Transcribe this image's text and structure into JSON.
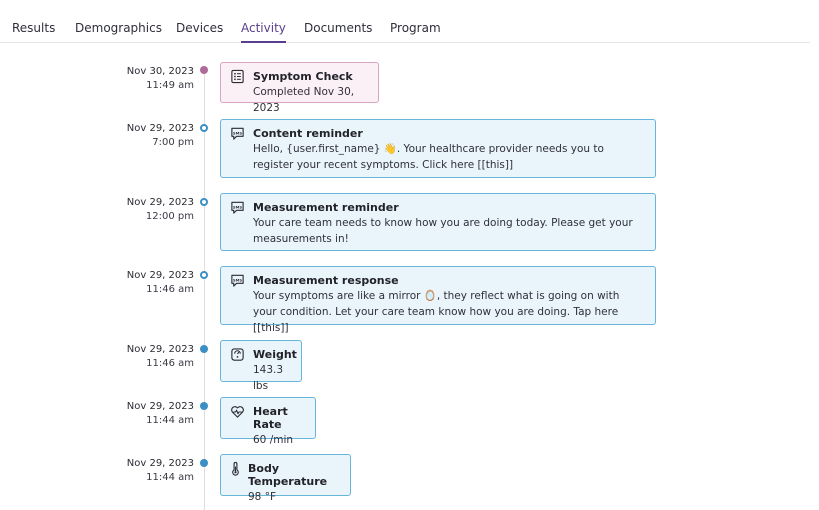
{
  "tabs": [
    {
      "label": "Results"
    },
    {
      "label": "Demographics"
    },
    {
      "label": "Devices"
    },
    {
      "label": "Activity"
    },
    {
      "label": "Documents"
    },
    {
      "label": "Program"
    }
  ],
  "active_tab": "Activity",
  "colors": {
    "accent": "#5a3e8e",
    "card_border": "#67b5d9",
    "card_bg": "#eaf5fb",
    "dot": "#3b8fc4",
    "pink_border": "#d9a3c2",
    "pink_dot": "#b06a9a"
  },
  "timeline": [
    {
      "date": "Nov 30, 2023",
      "time": "11:49 am",
      "title": "Symptom Check",
      "body": "Completed Nov 30, 2023",
      "icon": "checklist-icon",
      "style": "pink"
    },
    {
      "date": "Nov 29, 2023",
      "time": "7:00 pm",
      "title": "Content reminder",
      "body": "Hello, {user.first_name} 👋. Your healthcare provider needs you to register your recent symptoms. Click here [[this]]",
      "icon": "sms-icon",
      "style": "hollow"
    },
    {
      "date": "Nov 29, 2023",
      "time": "12:00 pm",
      "title": "Measurement reminder",
      "body": "Your care team needs to know how you are doing today. Please get your measurements in!",
      "icon": "sms-icon",
      "style": "hollow"
    },
    {
      "date": "Nov 29, 2023",
      "time": "11:46 am",
      "title": "Measurement response",
      "body": "Your symptoms are like a mirror 🪞, they reflect what is going on with your condition. Let your care team know how you are doing. Tap here [[this]]",
      "icon": "sms-icon",
      "style": "hollow"
    },
    {
      "date": "Nov 29, 2023",
      "time": "11:46 am",
      "title": "Weight",
      "body": "143.3 lbs",
      "icon": "scale-icon",
      "style": "filled"
    },
    {
      "date": "Nov 29, 2023",
      "time": "11:44 am",
      "title": "Heart Rate",
      "body": "60 /min",
      "icon": "heart-rate-icon",
      "style": "filled"
    },
    {
      "date": "Nov 29, 2023",
      "time": "11:44 am",
      "title": "Body Temperature",
      "body": "98 °F",
      "icon": "thermometer-icon",
      "style": "filled"
    }
  ]
}
